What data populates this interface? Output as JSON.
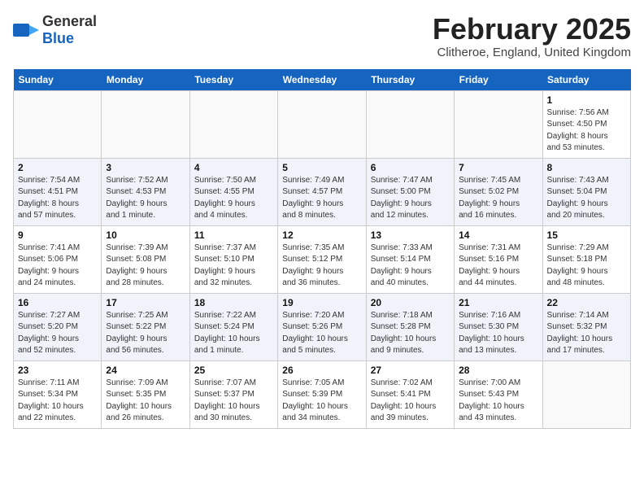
{
  "header": {
    "logo_general": "General",
    "logo_blue": "Blue",
    "title": "February 2025",
    "subtitle": "Clitheroe, England, United Kingdom"
  },
  "weekdays": [
    "Sunday",
    "Monday",
    "Tuesday",
    "Wednesday",
    "Thursday",
    "Friday",
    "Saturday"
  ],
  "weeks": [
    [
      {
        "day": "",
        "info": ""
      },
      {
        "day": "",
        "info": ""
      },
      {
        "day": "",
        "info": ""
      },
      {
        "day": "",
        "info": ""
      },
      {
        "day": "",
        "info": ""
      },
      {
        "day": "",
        "info": ""
      },
      {
        "day": "1",
        "info": "Sunrise: 7:56 AM\nSunset: 4:50 PM\nDaylight: 8 hours\nand 53 minutes."
      }
    ],
    [
      {
        "day": "2",
        "info": "Sunrise: 7:54 AM\nSunset: 4:51 PM\nDaylight: 8 hours\nand 57 minutes."
      },
      {
        "day": "3",
        "info": "Sunrise: 7:52 AM\nSunset: 4:53 PM\nDaylight: 9 hours\nand 1 minute."
      },
      {
        "day": "4",
        "info": "Sunrise: 7:50 AM\nSunset: 4:55 PM\nDaylight: 9 hours\nand 4 minutes."
      },
      {
        "day": "5",
        "info": "Sunrise: 7:49 AM\nSunset: 4:57 PM\nDaylight: 9 hours\nand 8 minutes."
      },
      {
        "day": "6",
        "info": "Sunrise: 7:47 AM\nSunset: 5:00 PM\nDaylight: 9 hours\nand 12 minutes."
      },
      {
        "day": "7",
        "info": "Sunrise: 7:45 AM\nSunset: 5:02 PM\nDaylight: 9 hours\nand 16 minutes."
      },
      {
        "day": "8",
        "info": "Sunrise: 7:43 AM\nSunset: 5:04 PM\nDaylight: 9 hours\nand 20 minutes."
      }
    ],
    [
      {
        "day": "9",
        "info": "Sunrise: 7:41 AM\nSunset: 5:06 PM\nDaylight: 9 hours\nand 24 minutes."
      },
      {
        "day": "10",
        "info": "Sunrise: 7:39 AM\nSunset: 5:08 PM\nDaylight: 9 hours\nand 28 minutes."
      },
      {
        "day": "11",
        "info": "Sunrise: 7:37 AM\nSunset: 5:10 PM\nDaylight: 9 hours\nand 32 minutes."
      },
      {
        "day": "12",
        "info": "Sunrise: 7:35 AM\nSunset: 5:12 PM\nDaylight: 9 hours\nand 36 minutes."
      },
      {
        "day": "13",
        "info": "Sunrise: 7:33 AM\nSunset: 5:14 PM\nDaylight: 9 hours\nand 40 minutes."
      },
      {
        "day": "14",
        "info": "Sunrise: 7:31 AM\nSunset: 5:16 PM\nDaylight: 9 hours\nand 44 minutes."
      },
      {
        "day": "15",
        "info": "Sunrise: 7:29 AM\nSunset: 5:18 PM\nDaylight: 9 hours\nand 48 minutes."
      }
    ],
    [
      {
        "day": "16",
        "info": "Sunrise: 7:27 AM\nSunset: 5:20 PM\nDaylight: 9 hours\nand 52 minutes."
      },
      {
        "day": "17",
        "info": "Sunrise: 7:25 AM\nSunset: 5:22 PM\nDaylight: 9 hours\nand 56 minutes."
      },
      {
        "day": "18",
        "info": "Sunrise: 7:22 AM\nSunset: 5:24 PM\nDaylight: 10 hours\nand 1 minute."
      },
      {
        "day": "19",
        "info": "Sunrise: 7:20 AM\nSunset: 5:26 PM\nDaylight: 10 hours\nand 5 minutes."
      },
      {
        "day": "20",
        "info": "Sunrise: 7:18 AM\nSunset: 5:28 PM\nDaylight: 10 hours\nand 9 minutes."
      },
      {
        "day": "21",
        "info": "Sunrise: 7:16 AM\nSunset: 5:30 PM\nDaylight: 10 hours\nand 13 minutes."
      },
      {
        "day": "22",
        "info": "Sunrise: 7:14 AM\nSunset: 5:32 PM\nDaylight: 10 hours\nand 17 minutes."
      }
    ],
    [
      {
        "day": "23",
        "info": "Sunrise: 7:11 AM\nSunset: 5:34 PM\nDaylight: 10 hours\nand 22 minutes."
      },
      {
        "day": "24",
        "info": "Sunrise: 7:09 AM\nSunset: 5:35 PM\nDaylight: 10 hours\nand 26 minutes."
      },
      {
        "day": "25",
        "info": "Sunrise: 7:07 AM\nSunset: 5:37 PM\nDaylight: 10 hours\nand 30 minutes."
      },
      {
        "day": "26",
        "info": "Sunrise: 7:05 AM\nSunset: 5:39 PM\nDaylight: 10 hours\nand 34 minutes."
      },
      {
        "day": "27",
        "info": "Sunrise: 7:02 AM\nSunset: 5:41 PM\nDaylight: 10 hours\nand 39 minutes."
      },
      {
        "day": "28",
        "info": "Sunrise: 7:00 AM\nSunset: 5:43 PM\nDaylight: 10 hours\nand 43 minutes."
      },
      {
        "day": "",
        "info": ""
      }
    ]
  ]
}
